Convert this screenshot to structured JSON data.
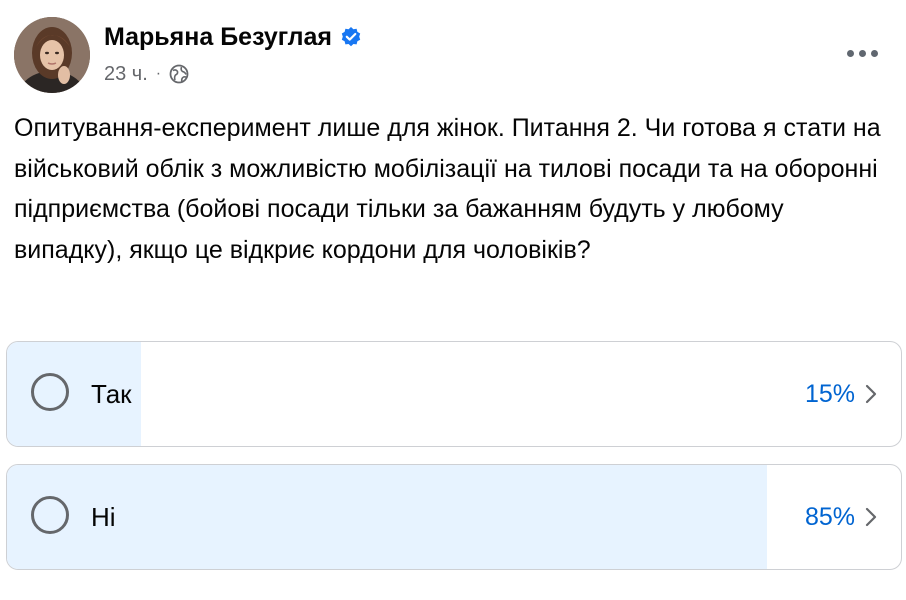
{
  "post": {
    "author_name": "Марьяна Безуглая",
    "timestamp": "23 ч.",
    "separator": "·",
    "text": "Опитування-експеримент лише для жінок. Питання 2. Чи готова я стати на військовий облік з можливістю мобілізації на тилові посади та на оборонні підприємства (бойові посади тільки за бажанням будуть у любому випадку), якщо це відкриє кордони для чоловіків?",
    "icons": {
      "verified": "verified-badge-icon",
      "audience": "globe-icon",
      "more": "more-options-icon"
    },
    "colors": {
      "verified": "#1877f2",
      "percent": "#0064d1",
      "poll_fill": "#e7f3ff",
      "meta": "#65676b"
    }
  },
  "poll": {
    "options": [
      {
        "label": "Так",
        "percent_text": "15%",
        "percent": 15
      },
      {
        "label": "Ні",
        "percent_text": "85%",
        "percent": 85
      }
    ]
  }
}
